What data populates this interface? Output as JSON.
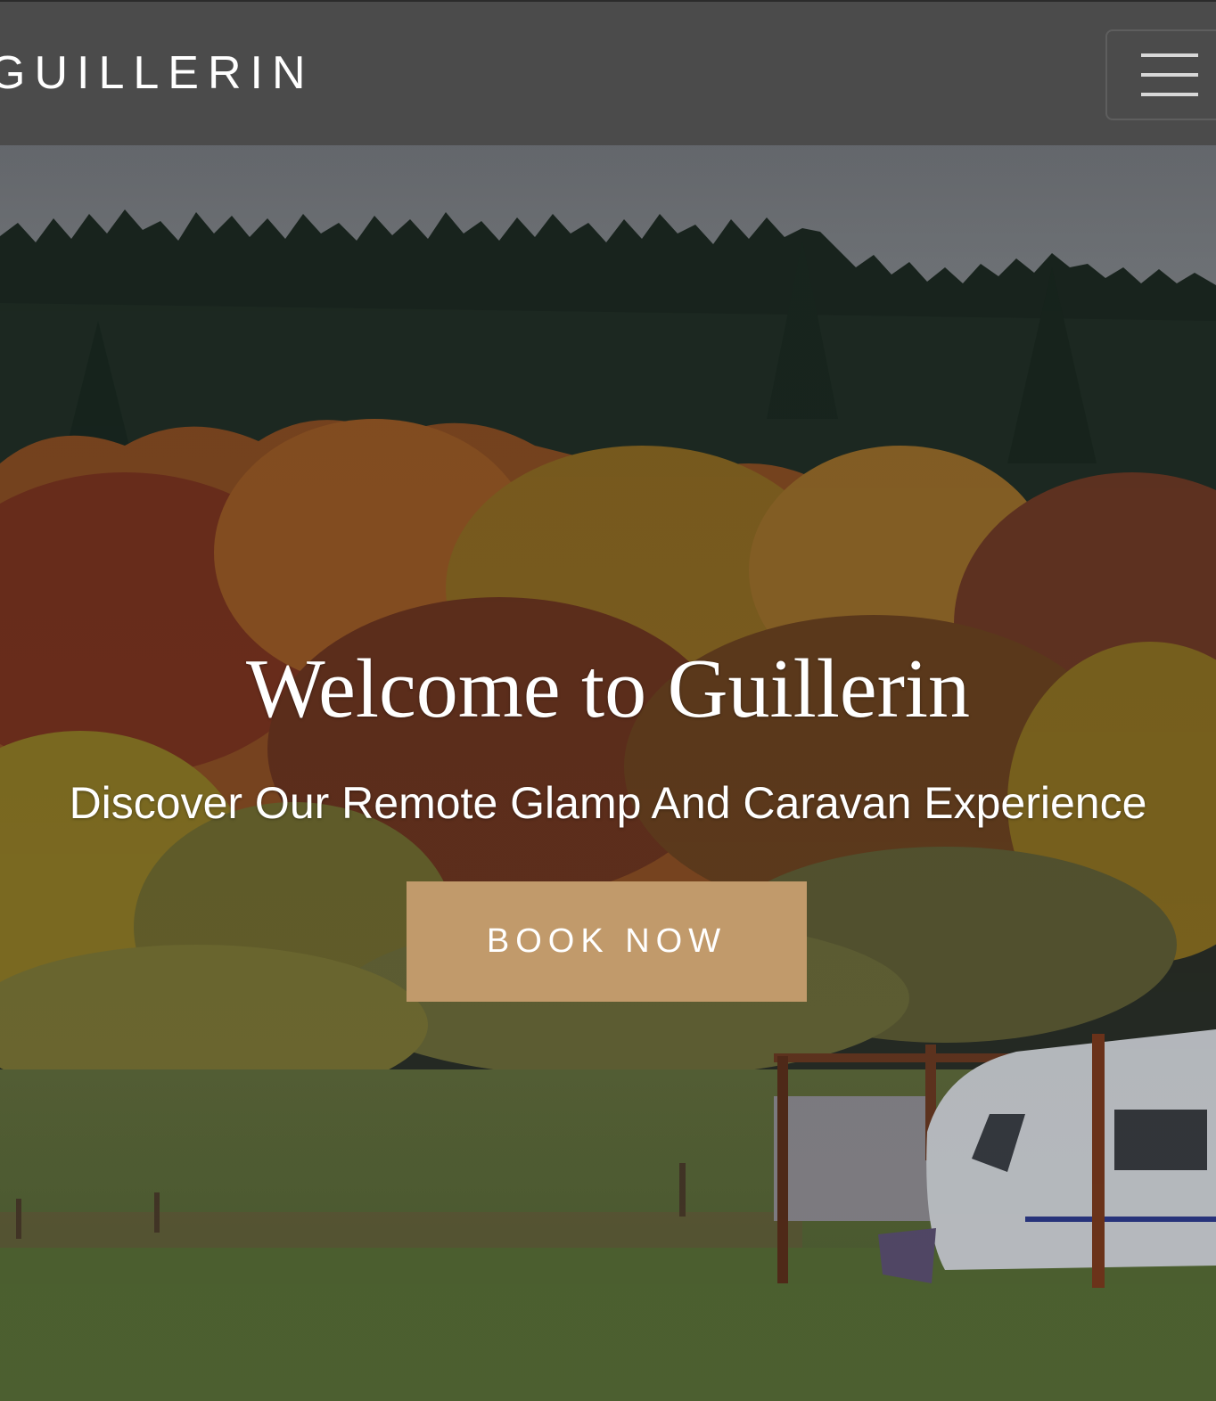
{
  "header": {
    "brand": "GUILLERIN",
    "menu_icon": "hamburger-menu-icon"
  },
  "hero": {
    "title": "Welcome to Guillerin",
    "subtitle": "Discover Our Remote Glamp And Caravan Experience",
    "cta_label": "BOOK NOW",
    "background_image": "autumn-forest-caravan-photo"
  },
  "colors": {
    "header_bg": "#4b4b4b",
    "cta_bg": "#c19a6b",
    "text": "#ffffff"
  }
}
